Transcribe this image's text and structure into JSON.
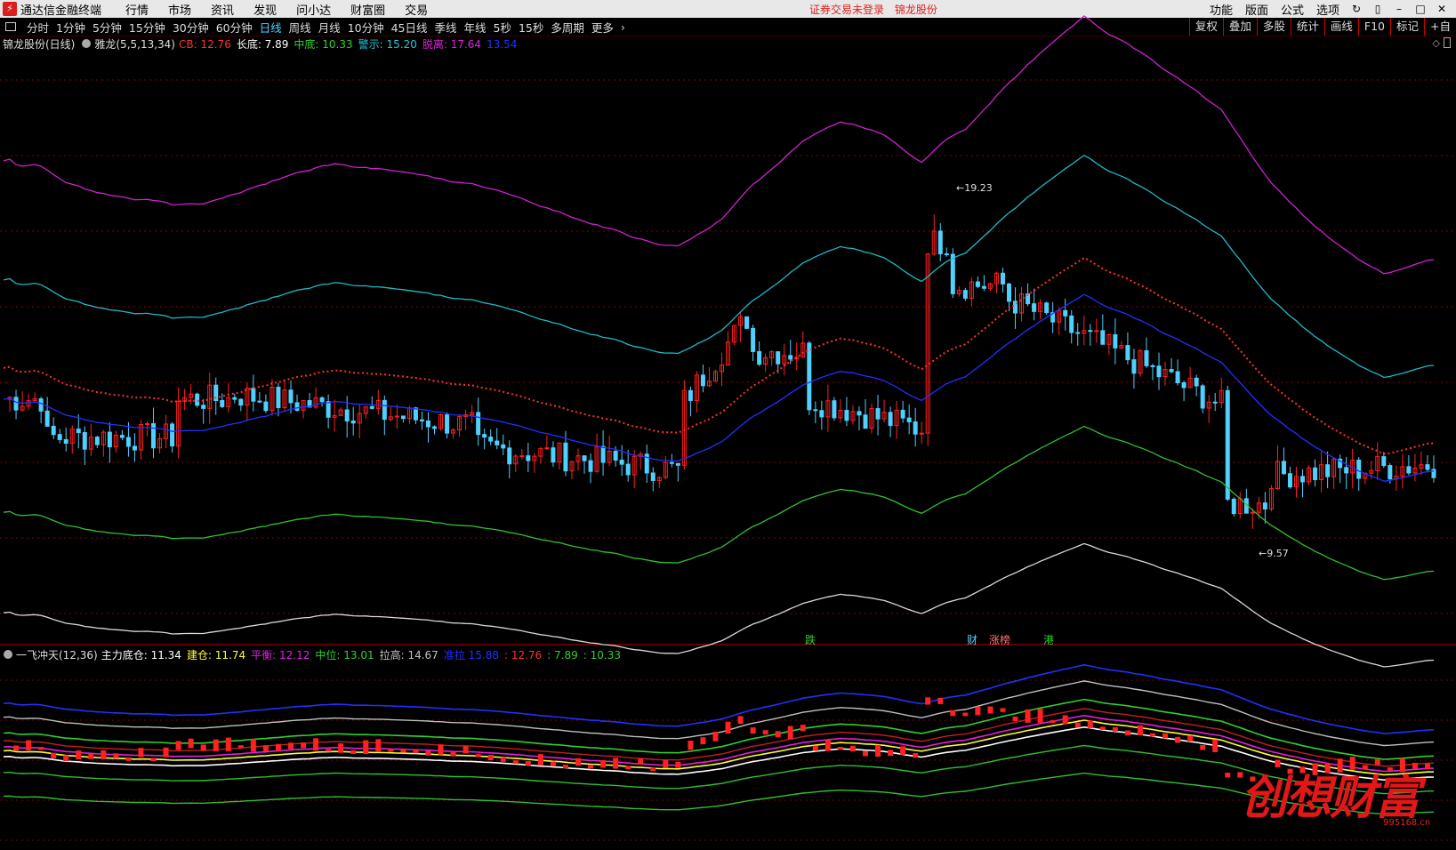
{
  "menubar": {
    "app_name": "通达信金融终端",
    "items": [
      "行情",
      "市场",
      "资讯",
      "发现",
      "问小达",
      "财富圈",
      "交易"
    ],
    "notice": "证券交易未登录",
    "stock_name": "锦龙股份",
    "right_items": [
      "功能",
      "版面",
      "公式",
      "选项"
    ]
  },
  "toolbar": {
    "periods": [
      "分时",
      "1分钟",
      "5分钟",
      "15分钟",
      "30分钟",
      "60分钟",
      "日线",
      "周线",
      "月线",
      "10分钟",
      "45日线",
      "季线",
      "年线",
      "5秒",
      "15秒",
      "多周期",
      "更多"
    ],
    "active_period": "日线",
    "right_buttons": [
      "复权",
      "叠加",
      "多股",
      "统计",
      "画线",
      "F10",
      "标记",
      "+自"
    ]
  },
  "main_indicator": {
    "title": "锦龙股份(日线)",
    "indicator_name": "雅龙(5,5,13,34)",
    "values": [
      {
        "label": "CB:",
        "value": "12.76",
        "color": "#ff3030"
      },
      {
        "label": "长底:",
        "value": "7.89",
        "color": "#ffffff"
      },
      {
        "label": "中底:",
        "value": "10.33",
        "color": "#30d030"
      },
      {
        "label": "警示:",
        "value": "15.20",
        "color": "#20c8d8"
      },
      {
        "label": "脱离:",
        "value": "17.64",
        "color": "#e020e0"
      },
      {
        "label": "",
        "value": "13.54",
        "color": "#2030ff"
      }
    ],
    "high_label": "19.23",
    "low_label": "9.57"
  },
  "events": [
    {
      "text": "跌",
      "color": "#30d030"
    },
    {
      "text": "财",
      "color": "#4fd0ff"
    },
    {
      "text": "涨榜",
      "color": "#ff7070"
    },
    {
      "text": "港",
      "color": "#30d030"
    }
  ],
  "sub_indicator": {
    "name": "一飞冲天(12,36)",
    "values": [
      {
        "label": "主力底仓:",
        "value": "11.34",
        "color": "#ffffff"
      },
      {
        "label": "建仓:",
        "value": "11.74",
        "color": "#ffff30"
      },
      {
        "label": "平衡:",
        "value": "12.12",
        "color": "#e020e0"
      },
      {
        "label": "中位:",
        "value": "13.01",
        "color": "#30d030"
      },
      {
        "label": "拉高:",
        "value": "14.67",
        "color": "#c0c0c0"
      },
      {
        "label": "准拉",
        "value": "15.88",
        "color": "#2030ff"
      },
      {
        "label": ":",
        "value": "12.76",
        "color": "#ff3030"
      },
      {
        "label": ":",
        "value": "7.89",
        "color": "#30d030"
      },
      {
        "label": ":",
        "value": "10.33",
        "color": "#30d030"
      }
    ]
  },
  "watermark": {
    "text": "创想财富",
    "url": "995168.cn"
  },
  "colors": {
    "up": "#ff2020",
    "down": "#4fd0ff",
    "grid": "#8a0000"
  }
}
